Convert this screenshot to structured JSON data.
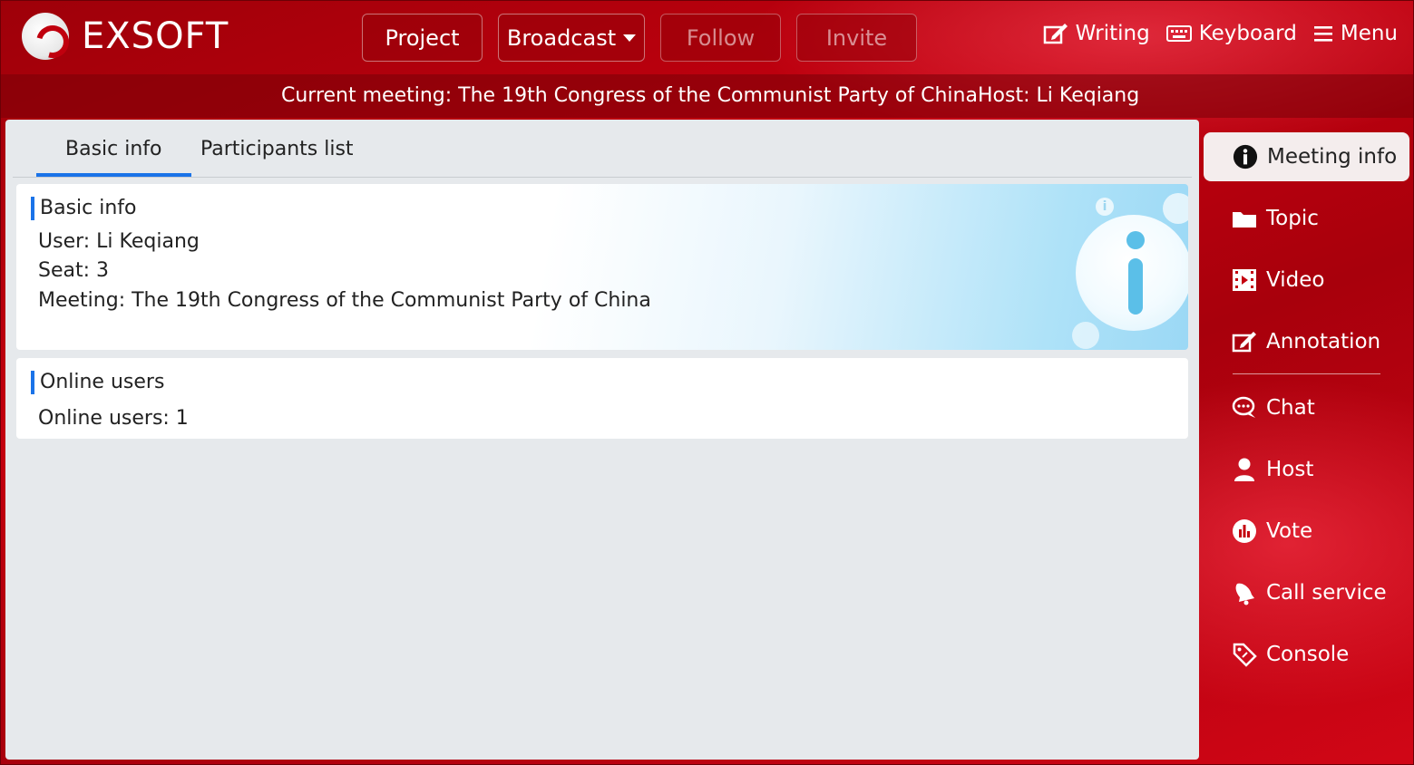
{
  "app": {
    "logo_text": "EXSOFT"
  },
  "nav": {
    "project": "Project",
    "broadcast": "Broadcast",
    "follow": "Follow",
    "invite": "Invite"
  },
  "tools": {
    "writing": "Writing",
    "keyboard": "Keyboard",
    "menu": "Menu"
  },
  "infobar": {
    "meeting": "Current meeting: The 19th Congress of the Communist Party of China",
    "host": "Host: Li Keqiang"
  },
  "tabs": {
    "basic": "Basic info",
    "participants": "Participants list"
  },
  "basic_card": {
    "title": "Basic info",
    "user": "User: Li Keqiang",
    "seat": "Seat: 3",
    "meeting": "Meeting: The 19th Congress of the Communist Party of China"
  },
  "online_card": {
    "title": "Online users",
    "count": "Online users: 1"
  },
  "side": {
    "meeting_info": "Meeting info",
    "topic": "Topic",
    "video": "Video",
    "annotation": "Annotation",
    "chat": "Chat",
    "host": "Host",
    "vote": "Vote",
    "call_service": "Call service",
    "console": "Console"
  },
  "colors": {
    "brand_red": "#c4000f",
    "accent_blue": "#1a73e8",
    "panel_bg": "#e6e9ec"
  }
}
